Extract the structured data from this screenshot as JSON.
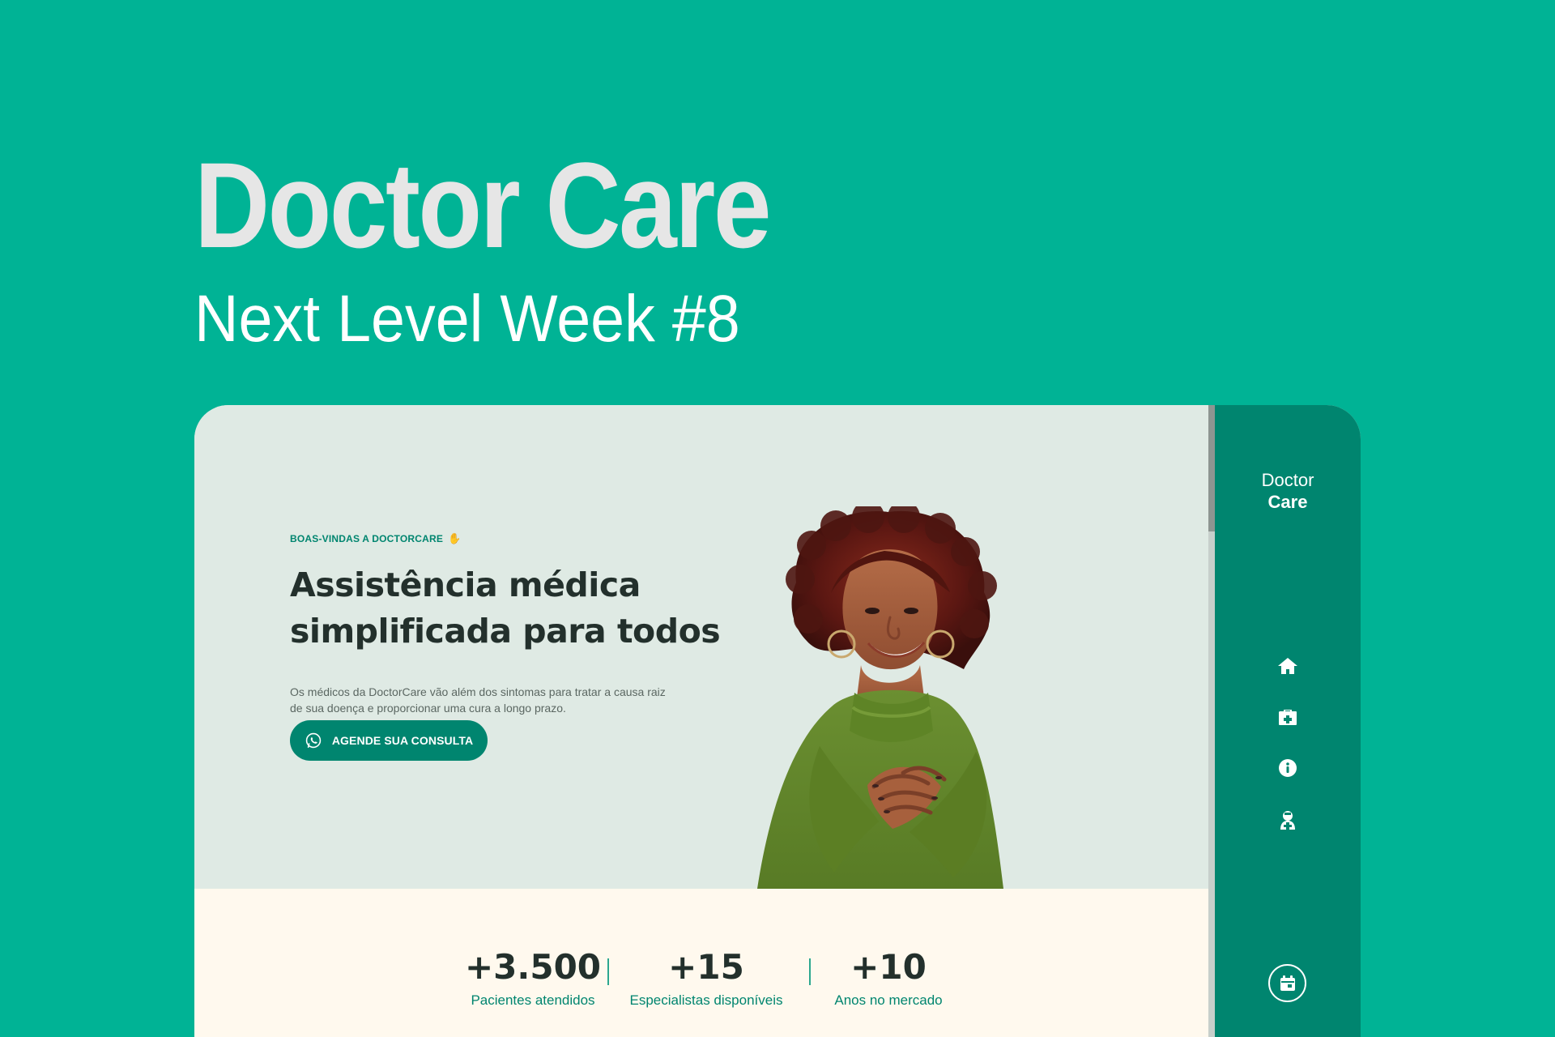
{
  "cover": {
    "title": "Doctor Care",
    "subtitle": "Next Level Week #8"
  },
  "hero": {
    "kicker": "BOAS-VINDAS A DOCTORCARE",
    "title_line_1": "Assistência médica",
    "title_line_2": "simplificada para todos",
    "description_line_1": "Os médicos da DoctorCare vão além dos sintomas para tratar a causa raiz",
    "description_line_2": "de sua doença e proporcionar uma cura a longo prazo.",
    "cta_label": "AGENDE SUA CONSULTA"
  },
  "stats": [
    {
      "value": "+3.500",
      "label": "Pacientes atendidos"
    },
    {
      "value": "+15",
      "label": "Especialistas disponíveis"
    },
    {
      "value": "+10",
      "label": "Anos no mercado"
    }
  ],
  "sidebar": {
    "brand_first": "Doctor",
    "brand_second": "Care",
    "icons": [
      "home-icon",
      "medical-kit-icon",
      "info-icon",
      "doctor-icon"
    ],
    "action_icon": "calendar-icon"
  },
  "colors": {
    "background": "#00b395",
    "accent": "#00856f",
    "hero_background": "#dfeae4",
    "stats_background": "#fff9ee",
    "text_dark": "#23302c"
  }
}
